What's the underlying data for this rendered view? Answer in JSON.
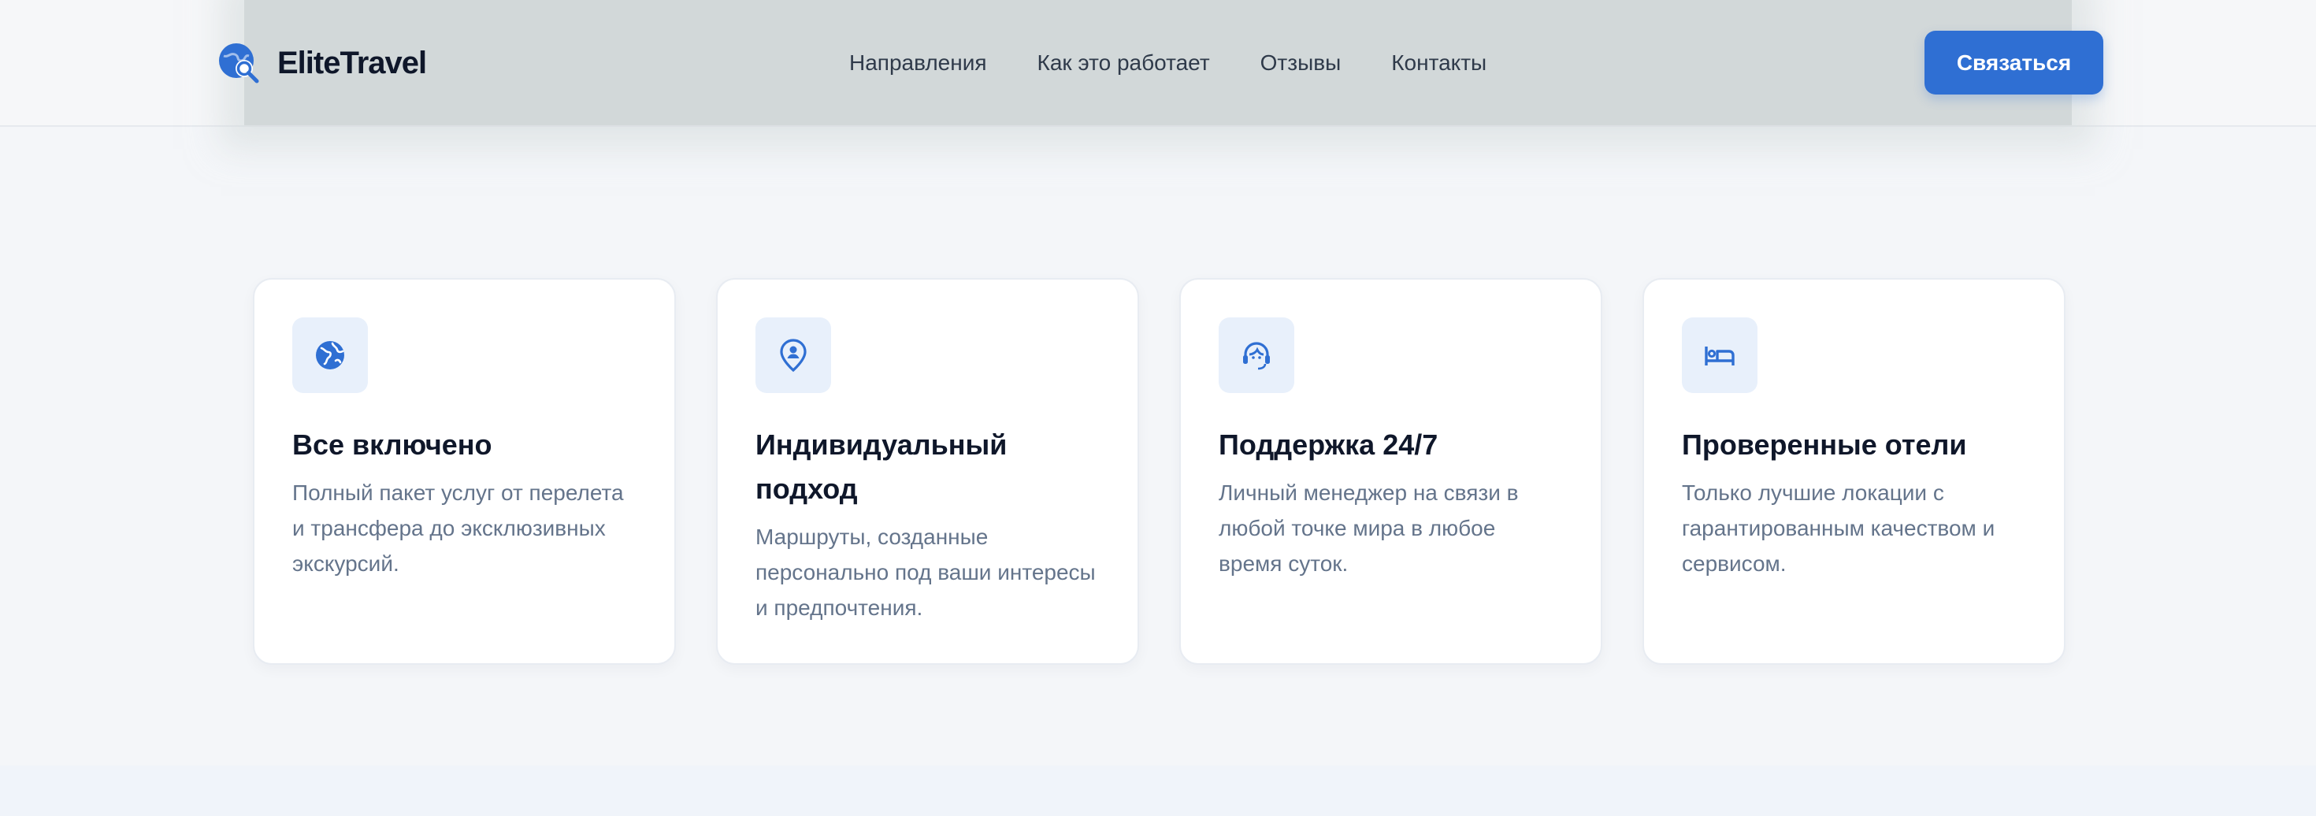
{
  "brand": {
    "name": "EliteTravel",
    "logo_icon": "globe-search-icon",
    "accent_color": "#2f6fd3"
  },
  "nav": {
    "items": [
      {
        "label": "Направления"
      },
      {
        "label": "Как это работает"
      },
      {
        "label": "Отзывы"
      },
      {
        "label": "Контакты"
      }
    ],
    "cta_label": "Связаться"
  },
  "features": [
    {
      "icon": "globe-icon",
      "title": "Все включено",
      "text": "Полный пакет услуг от перелета и трансфера до эксклюзивных экскурсий."
    },
    {
      "icon": "location-person-icon",
      "title": "Индивидуальный подход",
      "text": "Маршруты, созданные персонально под ваши интересы и предпочтения."
    },
    {
      "icon": "support-agent-icon",
      "title": "Поддержка 24/7",
      "text": "Личный менеджер на связи в любой точке мира в любое время суток."
    },
    {
      "icon": "hotel-bed-icon",
      "title": "Проверенные отели",
      "text": "Только лучшие локации с гарантированным качеством и сервисом."
    }
  ]
}
